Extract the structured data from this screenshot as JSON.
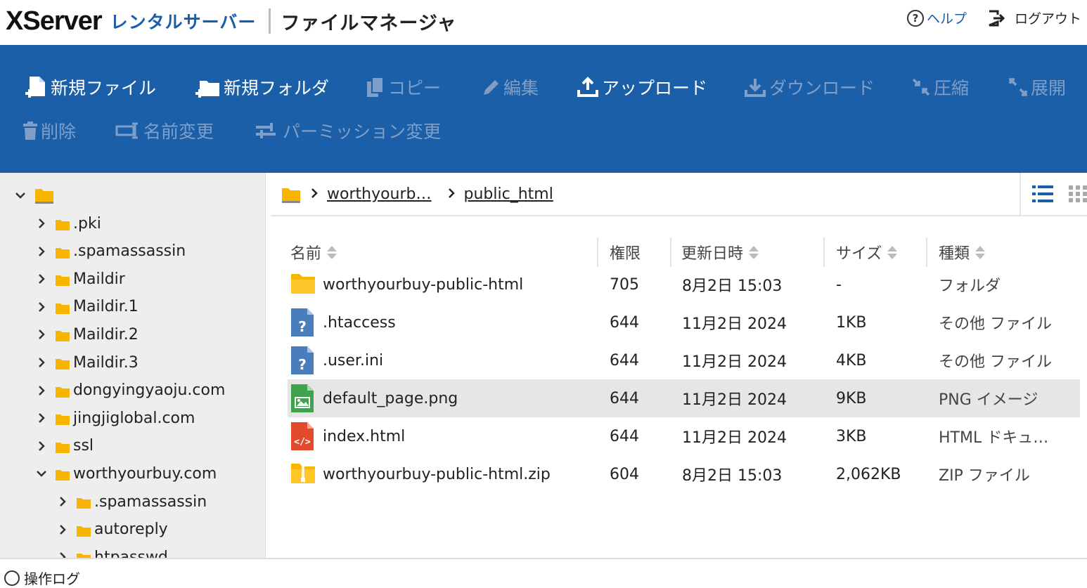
{
  "header": {
    "brand_name": "XServer",
    "brand_sub": "レンタルサーバー",
    "app_title": "ファイルマネージャ",
    "help_label": "ヘルプ",
    "logout_label": "ログアウト"
  },
  "toolbar": {
    "new_file": "新規ファイル",
    "new_folder": "新規フォルダ",
    "copy": "コピー",
    "edit": "編集",
    "upload": "アップロード",
    "download": "ダウンロード",
    "compress": "圧縮",
    "extract": "展開",
    "delete": "削除",
    "rename": "名前変更",
    "permission": "パーミッション変更"
  },
  "sidebar": {
    "items": [
      {
        "label": ".pki"
      },
      {
        "label": ".spamassassin"
      },
      {
        "label": "Maildir"
      },
      {
        "label": "Maildir.1"
      },
      {
        "label": "Maildir.2"
      },
      {
        "label": "Maildir.3"
      },
      {
        "label": "dongyingyaoju.com"
      },
      {
        "label": "jingjiglobal.com"
      },
      {
        "label": "ssl"
      },
      {
        "label": "worthyourbuy.com"
      },
      {
        "label": ".spamassassin"
      },
      {
        "label": "autoreply"
      },
      {
        "label": "htpasswd"
      }
    ]
  },
  "breadcrumb": {
    "items": [
      "worthyourb…",
      "public_html"
    ]
  },
  "table": {
    "headers": {
      "name": "名前",
      "perm": "権限",
      "date": "更新日時",
      "size": "サイズ",
      "kind": "種類"
    },
    "rows": [
      {
        "icon": "folder-icon",
        "name": "worthyourbuy-public-html",
        "perm": "705",
        "date": "8月2日 15:03",
        "size": "-",
        "kind": "フォルダ"
      },
      {
        "icon": "unknown-file-icon",
        "name": ".htaccess",
        "perm": "644",
        "date": "11月2日 2024",
        "size": "1KB",
        "kind": "その他 ファイル"
      },
      {
        "icon": "unknown-file-icon",
        "name": ".user.ini",
        "perm": "644",
        "date": "11月2日 2024",
        "size": "4KB",
        "kind": "その他 ファイル"
      },
      {
        "icon": "image-file-icon",
        "name": "default_page.png",
        "perm": "644",
        "date": "11月2日 2024",
        "size": "9KB",
        "kind": "PNG イメージ"
      },
      {
        "icon": "html-file-icon",
        "name": "index.html",
        "perm": "644",
        "date": "11月2日 2024",
        "size": "3KB",
        "kind": "HTML ドキュ…"
      },
      {
        "icon": "zip-file-icon",
        "name": "worthyourbuy-public-html.zip",
        "perm": "604",
        "date": "8月2日 15:03",
        "size": "2,062KB",
        "kind": "ZIP ファイル"
      }
    ]
  },
  "log": {
    "label": "操作ログ"
  },
  "colors": {
    "toolbar_bg": "#1b5fa8",
    "toolbar_disabled": "#7f9fc8",
    "folder": "#f7b500",
    "sidebar_bg": "#eeeeee",
    "selected_row": "#e6e6e6"
  }
}
